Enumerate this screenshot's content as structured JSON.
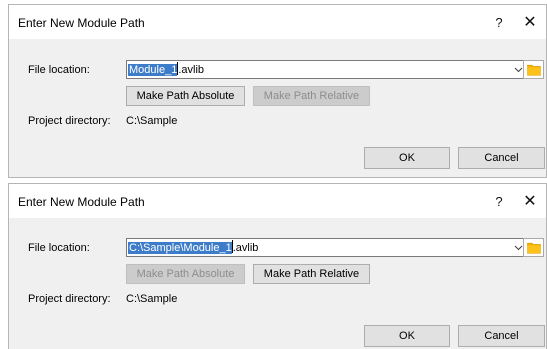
{
  "dialogs": [
    {
      "title": "Enter New Module Path",
      "help_glyph": "?",
      "close_glyph": "✕",
      "file_location_label": "File location:",
      "path_selected": "Module_1",
      "path_rest": ".avlib",
      "make_absolute_label": "Make Path Absolute",
      "make_absolute_enabled": true,
      "make_relative_label": "Make Path Relative",
      "make_relative_enabled": false,
      "project_directory_label": "Project directory:",
      "project_directory_value": "C:\\Sample",
      "ok_label": "OK",
      "cancel_label": "Cancel"
    },
    {
      "title": "Enter New Module Path",
      "help_glyph": "?",
      "close_glyph": "✕",
      "file_location_label": "File location:",
      "path_selected": "C:\\Sample\\Module_1",
      "path_rest": ".avlib",
      "make_absolute_label": "Make Path Absolute",
      "make_absolute_enabled": false,
      "make_relative_label": "Make Path Relative",
      "make_relative_enabled": true,
      "project_directory_label": "Project directory:",
      "project_directory_value": "C:\\Sample",
      "ok_label": "OK",
      "cancel_label": "Cancel"
    }
  ],
  "colors": {
    "selection": "#3d7cc9",
    "folder_icon": "#f5b400",
    "dialog_bg": "#f0f0f0",
    "titlebar_bg": "#ffffff"
  },
  "icons": {
    "folder": "folder-icon",
    "dropdown": "chevron-down-icon",
    "help": "help-icon",
    "close": "close-icon"
  }
}
